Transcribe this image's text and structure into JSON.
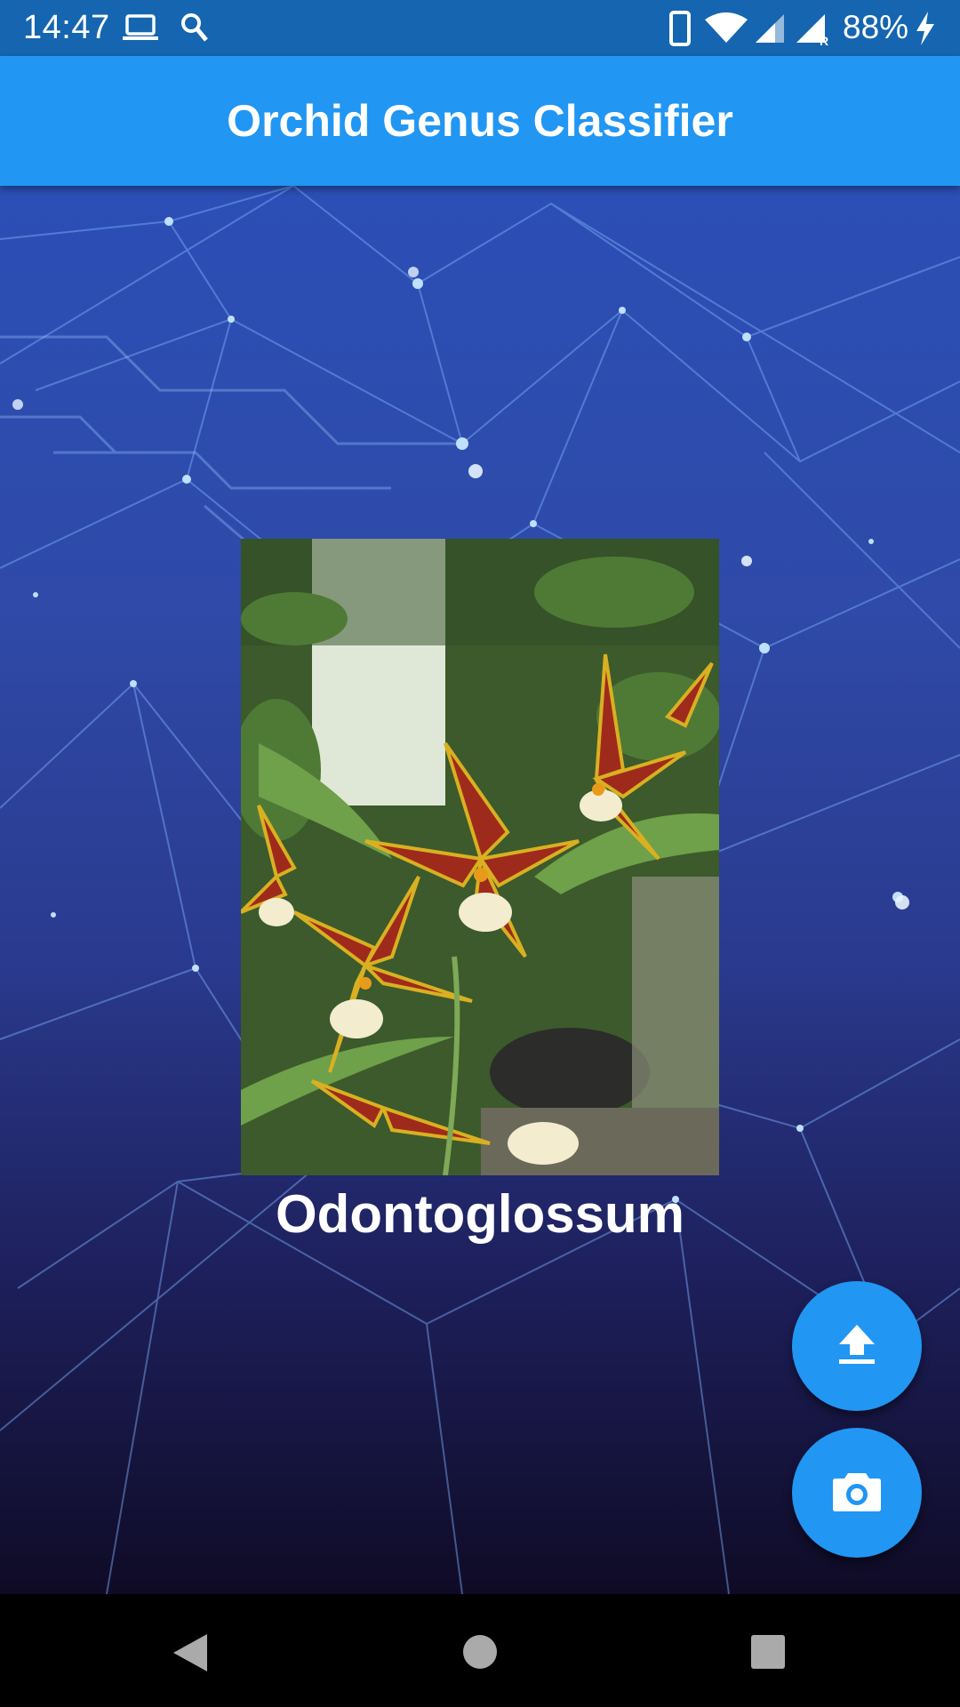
{
  "status_bar": {
    "time": "14:47",
    "battery": "88%",
    "icons": [
      "laptop-icon",
      "search-icon",
      "phone-icon",
      "wifi-icon",
      "signal-icon",
      "signal-roaming-icon",
      "charging-icon"
    ]
  },
  "app_bar": {
    "title": "Orchid Genus Classifier"
  },
  "main": {
    "image_description": "orchid-photo",
    "result_label": "Odontoglossum"
  },
  "actions": {
    "upload_icon": "upload-icon",
    "camera_icon": "camera-icon"
  },
  "nav_bar": {
    "icons": [
      "back-icon",
      "home-icon",
      "recents-icon"
    ]
  },
  "colors": {
    "primary": "#2196f3",
    "status_bar": "#1565b0"
  }
}
